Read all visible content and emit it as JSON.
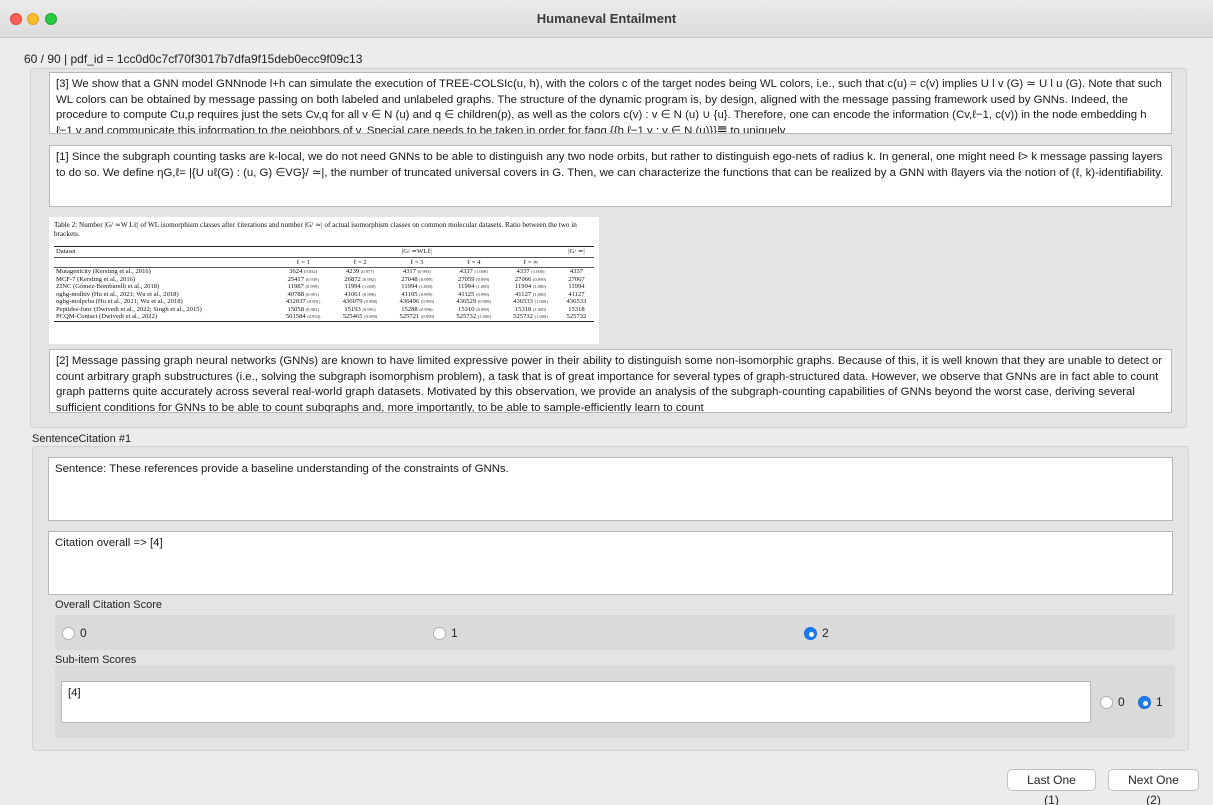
{
  "window": {
    "title": "Humaneval Entailment"
  },
  "header": {
    "info": "60 / 90 | pdf_id = 1cc0d0c7cf70f3017b7dfa9f15deb0ecc9f09c13"
  },
  "references": {
    "ref3": "[3] We show that a GNN model GNNnode l+h can simulate the execution of TREE-COLSIc(u, h), with the colors c of the target nodes being WL colors, i.e., such that c(u) = c(v) implies U l v (G) ≃ U l u (G). Note that such WL colors can be obtained by message passing on both labeled and unlabeled graphs. The structure of the dynamic program is, by design, aligned with the message passing framework used by GNNs. Indeed, the procedure to compute Cu,p requires just the sets Cv,q for all v ∈ N (u) and q ∈ children(p), as well as the colors c(v) : v ∈ N (u) ∪ {u}. Therefore, one can encode the information (Cv,ℓ−1, c(v)) in the node embedding h ℓ−1 v and communicate this information to the neighbors of v. Special care needs to be taken in order for fagg {{h ℓ−1 v : v ∈ N (u)}}𝌆 to uniquely",
    "ref1": "[1] Since the subgraph counting tasks are k-local, we do not need GNNs to be able to distinguish any two node orbits, but rather to distinguish ego-nets of radius k. In general, one might need ℓ> k message passing layers to do so. We define ηG,ℓ= |{U uℓ(G) : (u, G) ∈VG}/ ≃|, the number of truncated universal covers in G. Then, we can characterize the functions that can be realized by a GNN with ℓlayers via the notion of (ℓ, k)-identifiability.",
    "ref2": "[2] Message passing graph neural networks (GNNs) are known to have limited expressive power in their ability to distinguish some non-isomorphic graphs. Because of this, it is well known that they are unable to detect or count arbitrary graph substructures (i.e., solving the subgraph isomorphism problem), a task that is of great importance for several types of graph-structured data. However, we observe that GNNs are in fact able to count graph patterns quite accurately across several real-world graph datasets. Motivated by this observation, we provide an analysis of the subgraph-counting capabilities of GNNs beyond the worst case, deriving several sufficient conditions for GNNs to be able to count subgraphs and, more importantly, to be able to sample-efficiently learn to count"
  },
  "table_image": {
    "caption": "Table 2: Number |G/ ≃W Lℓ| of WL isomorphism classes after ℓiterations and number |G/ ≃| of actual isomorphism classes on common molecular datasets. Ratio between the two in brackets.",
    "col_dataset": "Dataset",
    "col_group": "|G/ ≃WLℓ|",
    "col_last": "|G/ ≃|",
    "subcols": [
      "ℓ = 1",
      "ℓ = 2",
      "ℓ = 3",
      "ℓ = 4",
      "ℓ = ∞"
    ],
    "rows": [
      {
        "name": "Mutagenicity (Kersting et al., 2016)",
        "vals": [
          [
            "3624",
            "(0.832)"
          ],
          [
            "4239",
            "(0.977)"
          ],
          [
            "4317",
            "(0.993)"
          ],
          [
            "4337",
            "(1.000)"
          ],
          [
            "4337",
            "(1.000)"
          ]
        ],
        "total": "4337"
      },
      {
        "name": "MCF-7 (Kersting et al., 2016)",
        "vals": [
          [
            "25417",
            "(0.939)"
          ],
          [
            "26872",
            "(0.992)"
          ],
          [
            "27048",
            "(0.999)"
          ],
          [
            "27059",
            "(0.999)"
          ],
          [
            "27066",
            "(0.999)"
          ]
        ],
        "total": "27067"
      },
      {
        "name": "ZINC (Gómez-Bombarelli et al., 2018)",
        "vals": [
          [
            "11987",
            "(0.999)"
          ],
          [
            "11994",
            "(1.000)"
          ],
          [
            "11994",
            "(1.000)"
          ],
          [
            "11994",
            "(1.000)"
          ],
          [
            "11994",
            "(1.000)"
          ]
        ],
        "total": "11994"
      },
      {
        "name": "ogbg-molhiv (Hu et al., 2021; Wu et al., 2018)",
        "vals": [
          [
            "40788",
            "(0.991)"
          ],
          [
            "41061",
            "(0.998)"
          ],
          [
            "41105",
            "(0.999)"
          ],
          [
            "41125",
            "(0.999)"
          ],
          [
            "41127",
            "(1.000)"
          ]
        ],
        "total": "41127"
      },
      {
        "name": "ogbg-molpcba (Hu et al., 2021; Wu et al., 2018)",
        "vals": [
          [
            "432037",
            "(0.991)"
          ],
          [
            "436079",
            "(0.998)"
          ],
          [
            "436496",
            "(0.999)"
          ],
          [
            "436529",
            "(0.999)"
          ],
          [
            "436533",
            "(1.000)"
          ]
        ],
        "total": "436533"
      },
      {
        "name": "Peptides-func (Dwivedi et al., 2022; Singh et al., 2015)",
        "vals": [
          [
            "15058",
            "(0.982)"
          ],
          [
            "15193",
            "(0.991)"
          ],
          [
            "15288",
            "(0.996)"
          ],
          [
            "15310",
            "(0.999)"
          ],
          [
            "15318",
            "(1.000)"
          ]
        ],
        "total": "15318"
      },
      {
        "name": "PCQM-Contact (Dwivedi et al., 2022)",
        "vals": [
          [
            "501584",
            "(0.954)"
          ],
          [
            "525465",
            "(0.999)"
          ],
          [
            "525721",
            "(0.999)"
          ],
          [
            "525732",
            "(1.000)"
          ],
          [
            "525732",
            "(1.000)"
          ]
        ],
        "total": "525732"
      }
    ]
  },
  "sentence_citation": {
    "group_label": "SentenceCitation #1",
    "sentence": "Sentence: These references provide a baseline understanding of the constraints of GNNs.",
    "citation": "Citation overall => [4]",
    "overall_label": "Overall Citation Score",
    "overall_options": [
      "0",
      "1",
      "2"
    ],
    "overall_selected": "2",
    "subitem_label": "Sub-item Scores",
    "subitem_text": "[4]",
    "subitem_options": [
      "0",
      "1"
    ],
    "subitem_selected": "1"
  },
  "buttons": {
    "last": "Last One (1)",
    "next": "Next One (2)"
  }
}
